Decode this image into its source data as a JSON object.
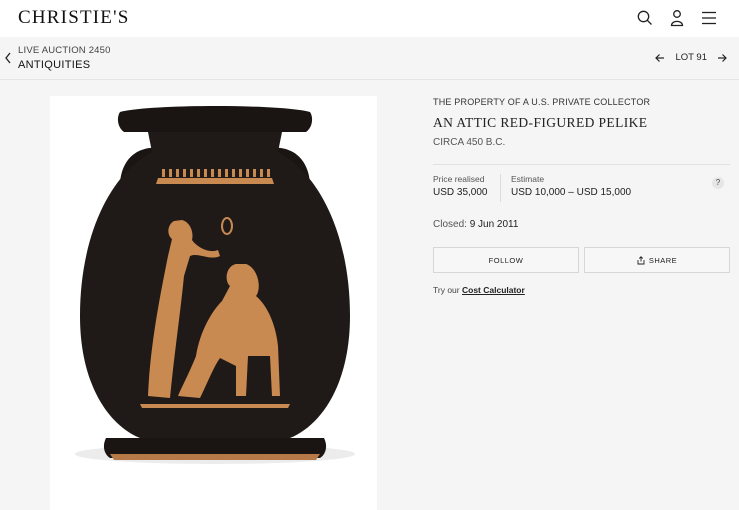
{
  "header": {
    "logo": "CHRISTIE'S",
    "icons": [
      "search-icon",
      "account-icon",
      "menu-icon"
    ]
  },
  "subheader": {
    "auction": "LIVE AUCTION 2450",
    "category": "ANTIQUITIES",
    "lot_label": "LOT 91"
  },
  "lot": {
    "provenance": "THE PROPERTY OF A U.S. PRIVATE COLLECTOR",
    "title": "AN ATTIC RED-FIGURED PELIKE",
    "date": "CIRCA 450 B.C.",
    "price_label": "Price realised",
    "price_value": "USD 35,000",
    "estimate_label": "Estimate",
    "estimate_value": "USD 10,000 – USD 15,000",
    "help": "?",
    "closed_label": "Closed:",
    "closed_date": "9 Jun 2011",
    "follow_label": "FOLLOW",
    "share_label": "SHARE",
    "cost_prefix": "Try our",
    "cost_link": "Cost Calculator"
  }
}
